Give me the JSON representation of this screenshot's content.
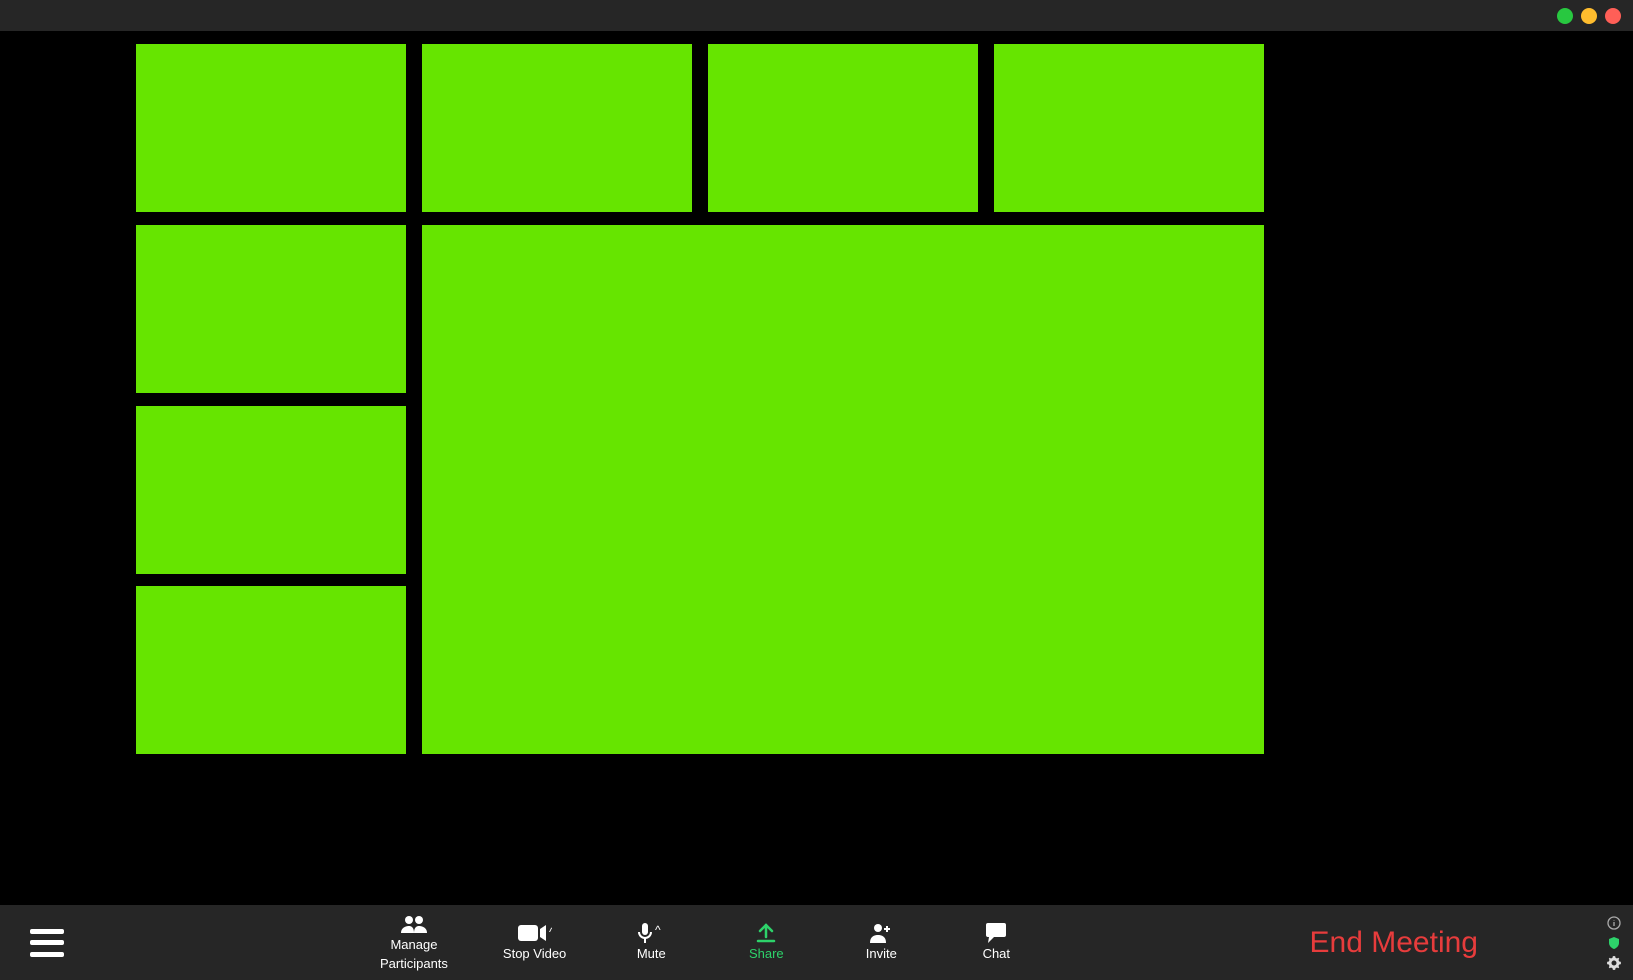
{
  "window_controls": {
    "colors": {
      "green": "#28c840",
      "yellow": "#ffbd2e",
      "red": "#ff5f57"
    }
  },
  "video_tile_color": "#66e500",
  "toolbar": {
    "manage_participants_line1": "Manage",
    "manage_participants_line2": "Participants",
    "stop_video_label": "Stop Video",
    "mute_label": "Mute",
    "share_label": "Share",
    "invite_label": "Invite",
    "chat_label": "Chat"
  },
  "end_meeting_label": "End Meeting",
  "icons": {
    "hamburger": "menu-icon",
    "participants": "people-icon",
    "stop_video": "camera-icon",
    "mute": "microphone-icon",
    "share": "upload-arrow-icon",
    "invite": "add-user-icon",
    "chat": "speech-bubble-icon",
    "info": "info-icon",
    "shield": "shield-icon",
    "gear": "gear-icon"
  }
}
